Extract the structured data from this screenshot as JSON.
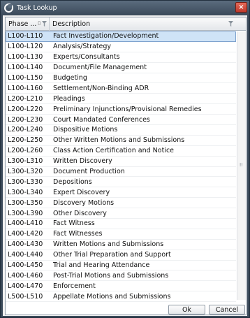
{
  "window": {
    "title": "Task Lookup",
    "close_glyph": "×"
  },
  "grid": {
    "columns": [
      {
        "label": "Phase ..."
      },
      {
        "label": "Description"
      }
    ],
    "rows": [
      {
        "phase": "L100-L110",
        "description": "Fact Investigation/Development",
        "selected": true
      },
      {
        "phase": "L100-L120",
        "description": "Analysis/Strategy"
      },
      {
        "phase": "L100-L130",
        "description": "Experts/Consultants"
      },
      {
        "phase": "L100-L140",
        "description": "Document/File Management"
      },
      {
        "phase": "L100-L150",
        "description": "Budgeting"
      },
      {
        "phase": "L100-L160",
        "description": "Settlement/Non-Binding ADR"
      },
      {
        "phase": "L200-L210",
        "description": "Pleadings"
      },
      {
        "phase": "L200-L220",
        "description": "Preliminary Injunctions/Provisional Remedies"
      },
      {
        "phase": "L200-L230",
        "description": "Court Mandated Conferences"
      },
      {
        "phase": "L200-L240",
        "description": "Dispositive Motions"
      },
      {
        "phase": "L200-L250",
        "description": "Other Written Motions and Submissions"
      },
      {
        "phase": "L200-L260",
        "description": "Class Action Certification and Notice"
      },
      {
        "phase": "L300-L310",
        "description": "Written Discovery"
      },
      {
        "phase": "L300-L320",
        "description": "Document Production"
      },
      {
        "phase": "L300-L330",
        "description": "Depositions"
      },
      {
        "phase": "L300-L340",
        "description": "Expert Discovery"
      },
      {
        "phase": "L300-L350",
        "description": "Discovery Motions"
      },
      {
        "phase": "L300-L390",
        "description": "Other Discovery"
      },
      {
        "phase": "L400-L410",
        "description": "Fact Witness"
      },
      {
        "phase": "L400-L420",
        "description": "Fact Witnesses"
      },
      {
        "phase": "L400-L430",
        "description": "Written Motions and Submissions"
      },
      {
        "phase": "L400-L440",
        "description": "Other Trial Preparation and Support"
      },
      {
        "phase": "L400-L450",
        "description": "Trial and Hearing Attendance"
      },
      {
        "phase": "L400-L460",
        "description": "Post-Trial Motions and Submissions"
      },
      {
        "phase": "L400-L470",
        "description": "Enforcement"
      },
      {
        "phase": "L500-L510",
        "description": "Appellate Motions and Submissions"
      }
    ]
  },
  "buttons": {
    "ok": "Ok",
    "cancel": "Cancel"
  },
  "icons": {
    "app": "app-logo-icon",
    "sort": "sort-icon",
    "filter": "filter-icon",
    "grip": "scroll-grip-icon"
  }
}
